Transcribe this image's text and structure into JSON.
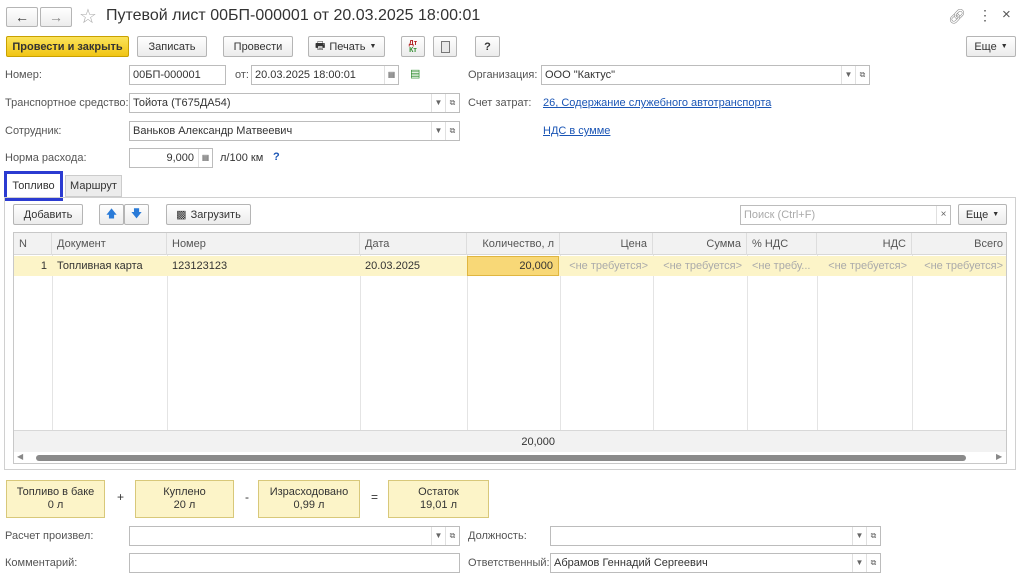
{
  "window": {
    "title": "Путевой лист 00БП-000001 от 20.03.2025 18:00:01"
  },
  "toolbar": {
    "post_close": "Провести и закрыть",
    "save": "Записать",
    "post": "Провести",
    "print": "Печать",
    "more": "Еще",
    "help": "?"
  },
  "header": {
    "number_label": "Номер:",
    "number": "00БП-000001",
    "date_label": "от:",
    "date": "20.03.2025 18:00:01",
    "org_label": "Организация:",
    "org": "ООО \"Кактус\"",
    "vehicle_label": "Транспортное средство:",
    "vehicle": "Тойота (Т675ДА54)",
    "account_label": "Счет затрат:",
    "account_link": "26, Содержание служебного автотранспорта",
    "employee_label": "Сотрудник:",
    "employee": "Ваньков Александр Матвеевич",
    "vat_link": "НДС в сумме",
    "norm_label": "Норма расхода:",
    "norm": "9,000",
    "norm_unit": "л/100 км",
    "norm_help": "?"
  },
  "tabs": [
    {
      "label": "Топливо"
    },
    {
      "label": "Маршрут"
    }
  ],
  "table_toolbar": {
    "add": "Добавить",
    "load": "Загрузить",
    "search_placeholder": "Поиск (Ctrl+F)",
    "more": "Еще"
  },
  "table": {
    "columns": [
      "N",
      "Документ",
      "Номер",
      "Дата",
      "Количество, л",
      "Цена",
      "Сумма",
      "% НДС",
      "НДС",
      "Всего"
    ],
    "rows": [
      {
        "n": "1",
        "document": "Топливная карта",
        "number": "123123123",
        "date": "20.03.2025",
        "quantity": "20,000",
        "price": "<не требуется>",
        "sum": "<не требуется>",
        "vat_pct": "<не требу...",
        "vat": "<не требуется>",
        "total": "<не требуется>"
      }
    ],
    "footer_quantity": "20,000"
  },
  "balance": {
    "in_tank_label": "Топливо в баке",
    "in_tank_value": "0 л",
    "plus": "+",
    "bought_label": "Куплено",
    "bought_value": "20 л",
    "minus": "-",
    "used_label": "Израсходовано",
    "used_value": "0,99 л",
    "equals": "=",
    "rest_label": "Остаток",
    "rest_value": "19,01 л"
  },
  "footer": {
    "calc_by_label": "Расчет произвел:",
    "calc_by": "",
    "position_label": "Должность:",
    "position": "",
    "comment_label": "Комментарий:",
    "comment": "",
    "responsible_label": "Ответственный:",
    "responsible": "Абрамов Геннадий Сергеевич"
  },
  "colors": {
    "accent": "#f1c514",
    "selected_row": "#fcf4c8",
    "tab_highlight": "#2b3bd1",
    "link": "#1a55b5"
  }
}
